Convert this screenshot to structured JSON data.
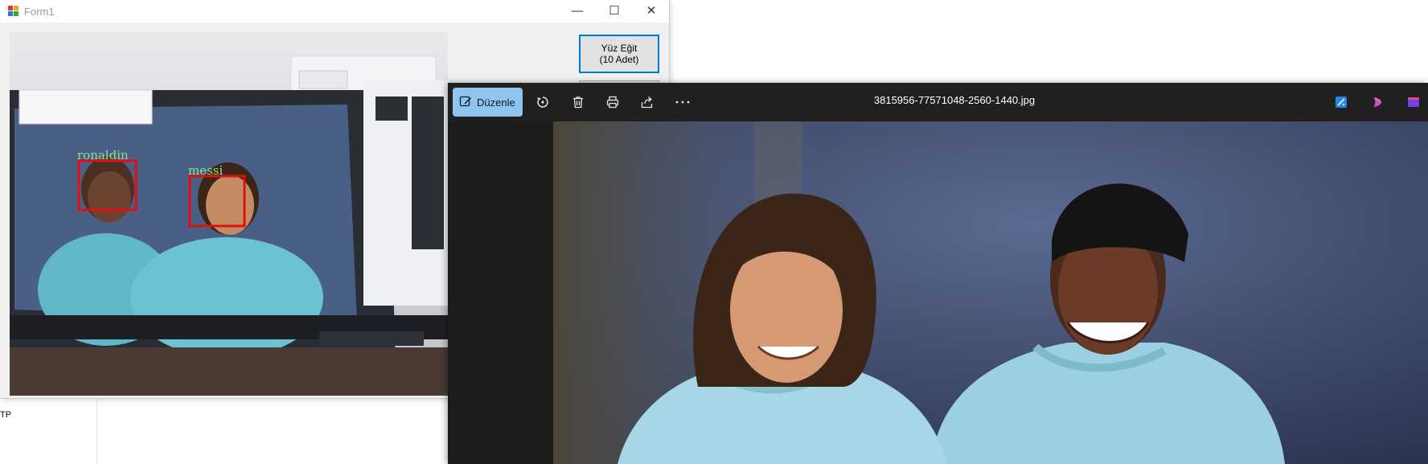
{
  "form1": {
    "title": "Form1",
    "train_button": {
      "line1": "Yüz Eğit",
      "line2": "(10 Adet)"
    },
    "feed_labels": {
      "face1": "ronaldin",
      "face2": "messi"
    }
  },
  "photos": {
    "edit_label": "Düzenle",
    "file_name": "3815956-77571048-2560-1440.jpg"
  },
  "desktop": {
    "fragment_text": "TP"
  },
  "icons": {
    "app": "app-icon",
    "minimize": "minimize-icon",
    "maximize": "maximize-icon",
    "close": "close-icon",
    "edit": "edit-icon",
    "rotate": "rotate-icon",
    "delete": "trash-icon",
    "print": "print-icon",
    "share": "share-icon",
    "more": "more-icon",
    "enhance": "enhance-icon",
    "copilot": "copilot-icon",
    "clipchamp": "clipchamp-icon"
  },
  "colors": {
    "detection_box": "#e01010",
    "label_text": "#8be28b",
    "accent": "#0078d7",
    "edit_button": "#8fc4ef"
  }
}
